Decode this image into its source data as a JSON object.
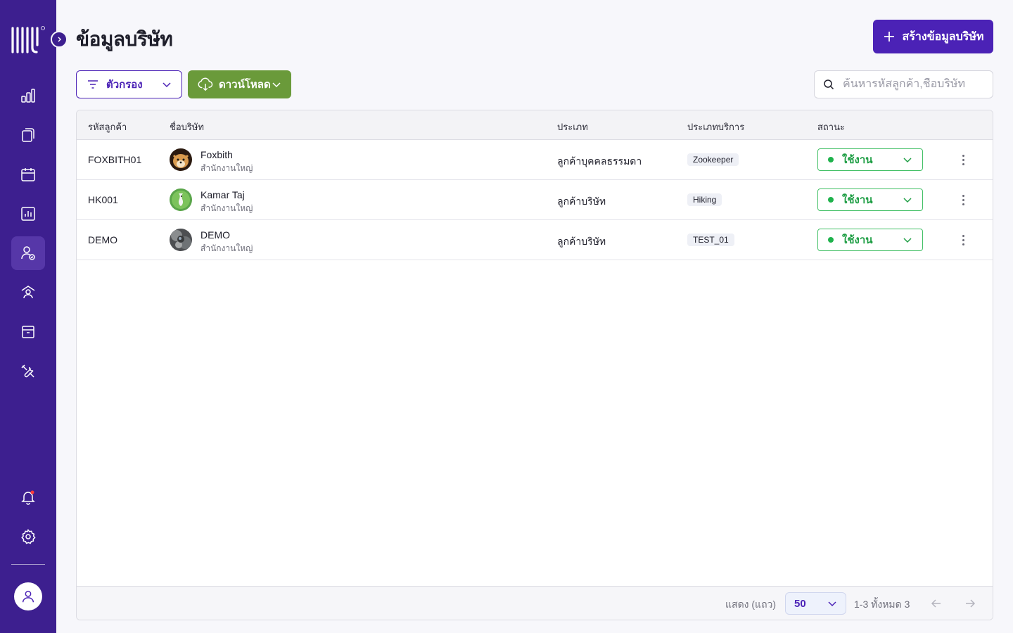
{
  "page": {
    "title": "ข้อมูลบริษัท",
    "create_button": "สร้างข้อมูลบริษัท"
  },
  "toolbar": {
    "filter_label": "ตัวกรอง",
    "download_label": "ดาวน์โหลด",
    "search_placeholder": "ค้นหารหัสลูกค้า,ชื่อบริษัท"
  },
  "table": {
    "columns": [
      "รหัสลูกค้า",
      "ชื่อบริษัท",
      "ประเภท",
      "ประเภทบริการ",
      "สถานะ"
    ],
    "rows": [
      {
        "code": "FOXBITH01",
        "name": "Foxbith",
        "branch": "สำนักงานใหญ่",
        "type": "ลูกค้าบุคคลธรรมดา",
        "service": "Zookeeper",
        "status": "ใช้งาน"
      },
      {
        "code": "HK001",
        "name": "Kamar Taj",
        "branch": "สำนักงานใหญ่",
        "type": "ลูกค้าบริษัท",
        "service": "Hiking",
        "status": "ใช้งาน"
      },
      {
        "code": "DEMO",
        "name": "DEMO",
        "branch": "สำนักงานใหญ่",
        "type": "ลูกค้าบริษัท",
        "service": "TEST_01",
        "status": "ใช้งาน"
      }
    ]
  },
  "pagination": {
    "rows_label": "แสดง (แถว)",
    "rows_per_page": "50",
    "range": "1-3 ทั้งหมด 3"
  },
  "sidebar": {
    "items": [
      "dashboard-icon",
      "documents-icon",
      "calendar-icon",
      "report-icon",
      "customer-icon",
      "team-icon",
      "archive-icon",
      "tools-icon"
    ],
    "bottom": [
      "bell-icon",
      "gear-icon",
      "user-icon"
    ]
  },
  "colors": {
    "sidebar": "#3d1f8f",
    "primary": "#4b22b6",
    "download": "#6a9a3a",
    "status_active": "#1fb24c"
  }
}
